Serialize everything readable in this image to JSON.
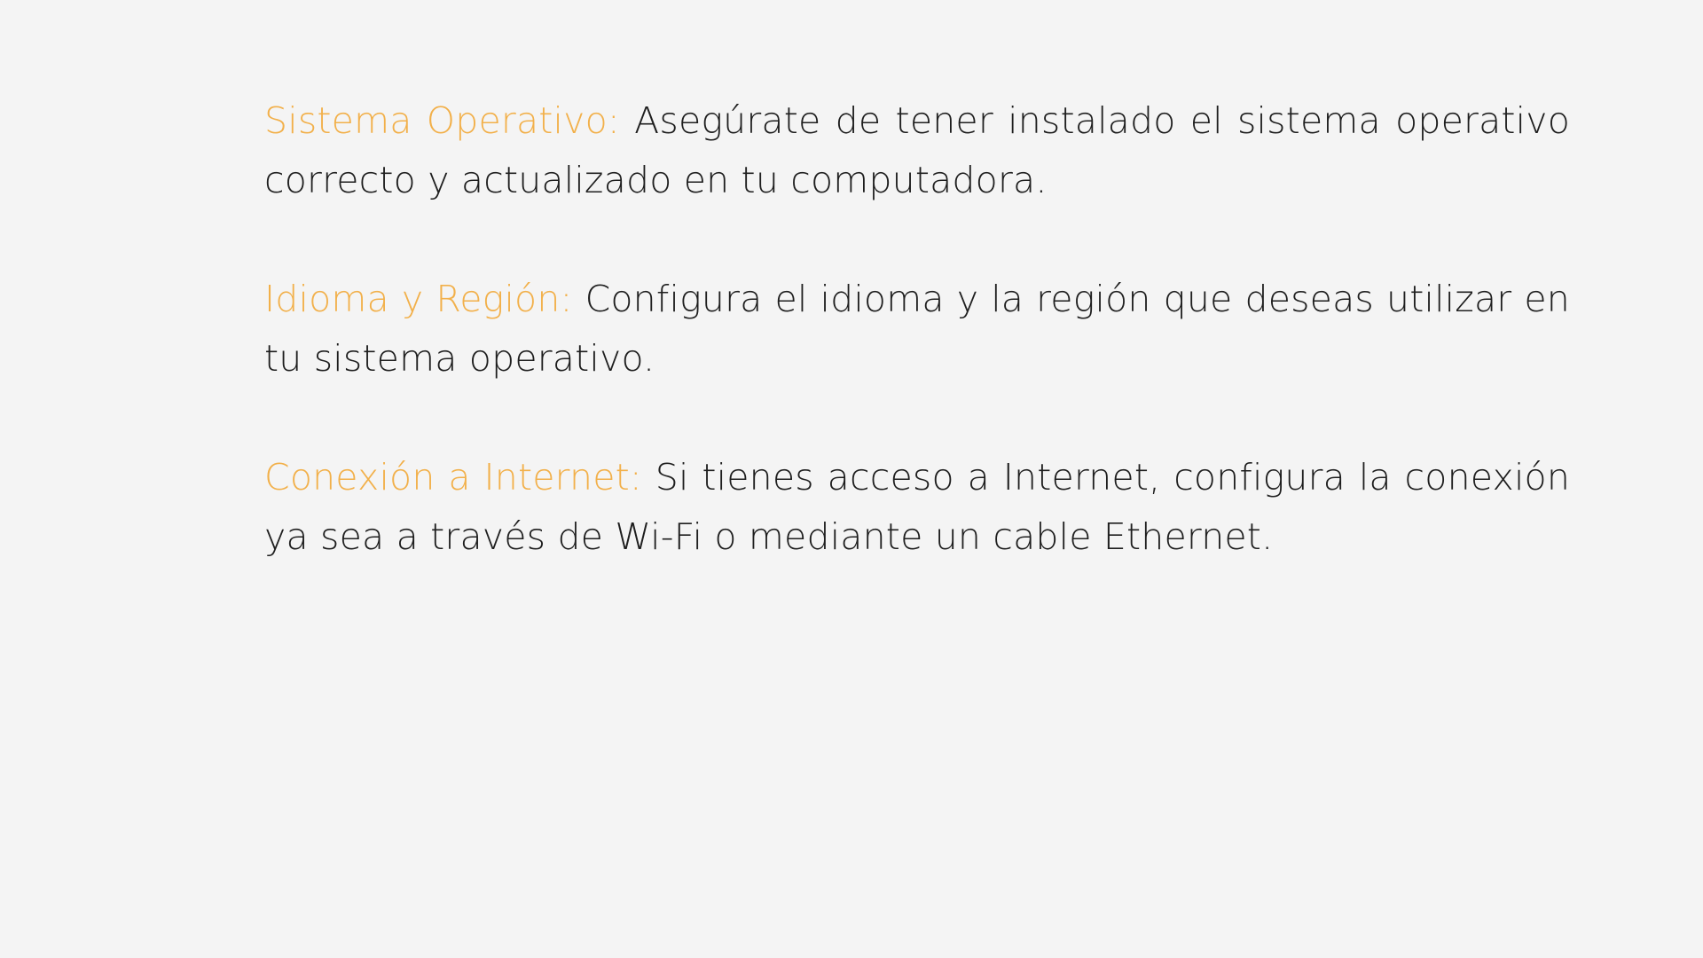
{
  "items": [
    {
      "term": "Sistema Operativo:",
      "description": "Asegúrate de tener instalado el sistema operativo correcto y actualizado en tu computadora."
    },
    {
      "term": "Idioma y Región:",
      "description": "Configura el idioma y la región que deseas utilizar en tu sistema operativo."
    },
    {
      "term": "Conexión a Internet:",
      "description": "Si tienes acceso a Internet, configura la conexión ya sea a través de Wi-Fi o mediante un cable Ethernet."
    }
  ],
  "colors": {
    "term_accent": "#f2b04a",
    "body_text": "#1e1e1e",
    "background": "#f4f4f4"
  }
}
